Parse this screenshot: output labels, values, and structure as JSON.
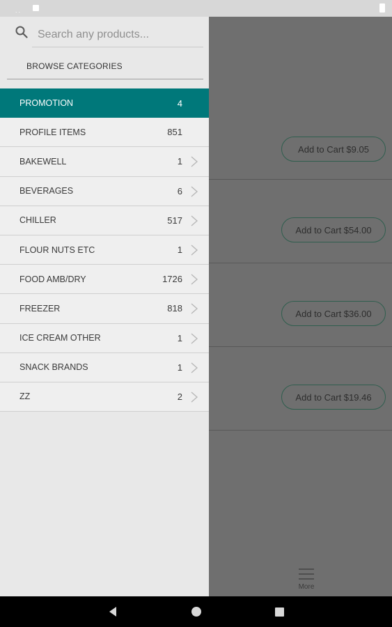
{
  "search": {
    "placeholder": "Search any products..."
  },
  "browse": {
    "label": "BROWSE CATEGORIES"
  },
  "categories": [
    {
      "name": "PROMOTION",
      "count": "4",
      "active": true,
      "chevron": false
    },
    {
      "name": "PROFILE ITEMS",
      "count": "851",
      "active": false,
      "chevron": false
    },
    {
      "name": "BAKEWELL",
      "count": "1",
      "active": false,
      "chevron": true
    },
    {
      "name": "BEVERAGES",
      "count": "6",
      "active": false,
      "chevron": true
    },
    {
      "name": "CHILLER",
      "count": "517",
      "active": false,
      "chevron": true
    },
    {
      "name": "FLOUR NUTS ETC",
      "count": "1",
      "active": false,
      "chevron": true
    },
    {
      "name": "FOOD AMB/DRY",
      "count": "1726",
      "active": false,
      "chevron": true
    },
    {
      "name": "FREEZER",
      "count": "818",
      "active": false,
      "chevron": true
    },
    {
      "name": "ICE CREAM OTHER",
      "count": "1",
      "active": false,
      "chevron": true
    },
    {
      "name": "SNACK BRANDS",
      "count": "1",
      "active": false,
      "chevron": true
    },
    {
      "name": "ZZ",
      "count": "2",
      "active": false,
      "chevron": true
    }
  ],
  "products": [
    {
      "cart_label": "Add to Cart $9.05"
    },
    {
      "cart_label": "Add to Cart $54.00"
    },
    {
      "cart_label": "Add to Cart $36.00"
    },
    {
      "cart_label": "Add to Cart $19.46"
    }
  ],
  "bottom_nav": {
    "more_label": "More"
  },
  "colors": {
    "accent": "#00787a",
    "drawer_bg": "#e8e8e8",
    "scrim": "#6f6f6f",
    "button_border": "#2f5e4e"
  },
  "icons": {
    "search": "search-icon",
    "chevron": "chevron-right-icon",
    "more": "hamburger-icon"
  }
}
